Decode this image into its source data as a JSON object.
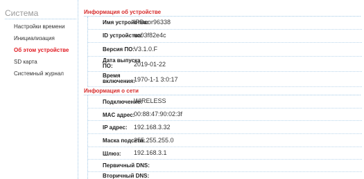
{
  "sidebar": {
    "title": "Система",
    "items": [
      {
        "label": "Настройки времени"
      },
      {
        "label": "Инициализация"
      },
      {
        "label": "Об этом устройстве",
        "active": true
      },
      {
        "label": "SD карта"
      },
      {
        "label": "Системный журнал"
      }
    ]
  },
  "device_info": {
    "title": "Информация об устройстве",
    "rows": [
      {
        "label": "Имя устройства:",
        "value": "IPDoor96338"
      },
      {
        "label": "ID устройства:",
        "value": "uc03f82e4c"
      },
      {
        "label": "Версия ПО:",
        "value": "V3.1.0.F"
      },
      {
        "label_line1": "Дата выпуска",
        "label_line2": "ПО:",
        "value": "2019-01-22"
      },
      {
        "label_line1": "Время",
        "label_line2": "включения:",
        "value": "1970-1-1 3:0:17"
      }
    ]
  },
  "network_info": {
    "title": "Информация о сети",
    "rows": [
      {
        "label": "Подключение:",
        "value": "WIRELESS"
      },
      {
        "label": "MAC адрес:",
        "value": "00:88:47:90:02:3f"
      },
      {
        "label": "IP адрес:",
        "value": "192.168.3.32"
      },
      {
        "label": "Маска подсети:",
        "value": "255.255.255.0"
      },
      {
        "label": "Шлюз:",
        "value": "192.168.3.1"
      },
      {
        "label": "Первичный DNS:",
        "value": ""
      },
      {
        "label": "Вторичный DNS:",
        "value": ""
      }
    ]
  },
  "colors": {
    "accent_red": "#d62b2b",
    "active_nav": "#e11b22",
    "divider_blue": "#9fc7e6"
  }
}
